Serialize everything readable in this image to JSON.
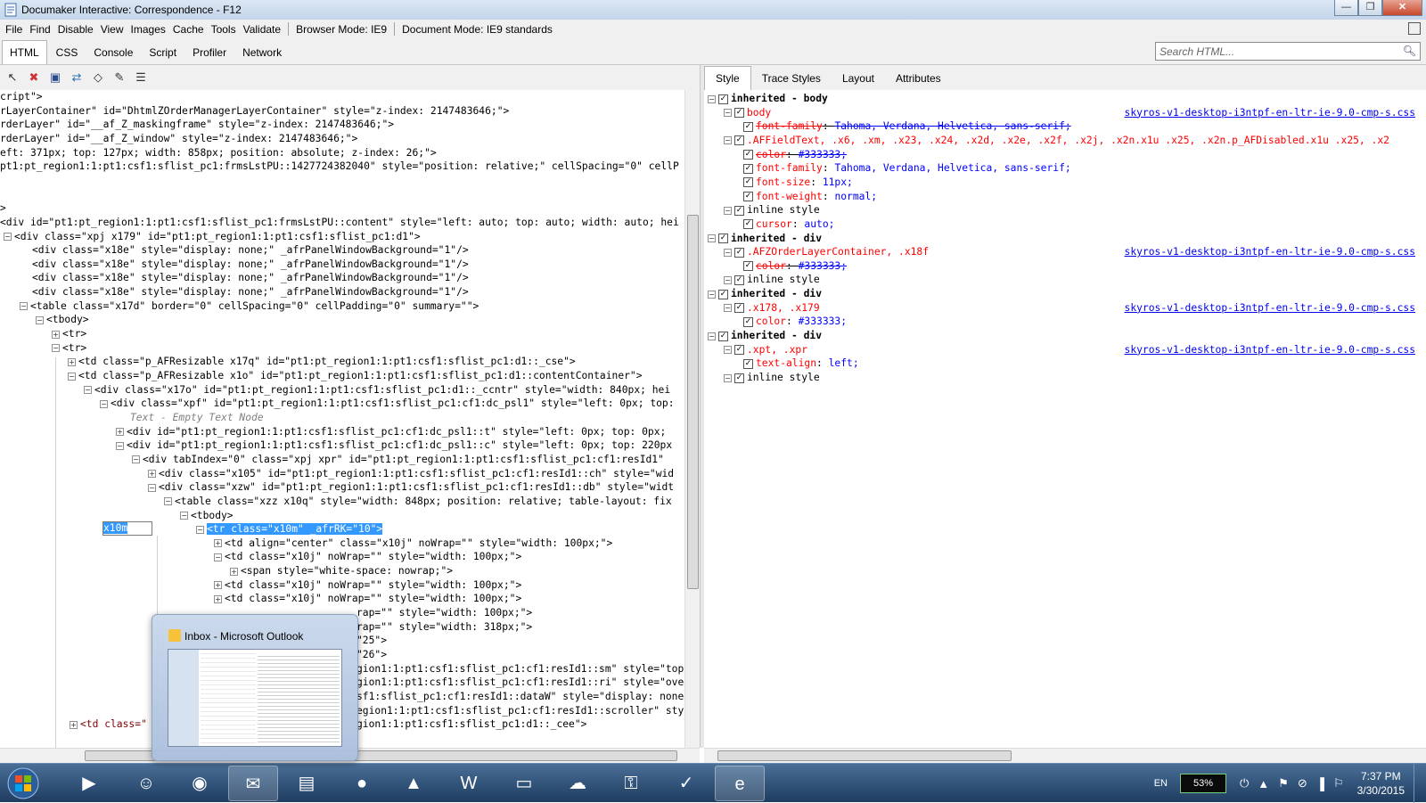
{
  "window": {
    "title": "Documaker Interactive: Correspondence - F12",
    "buttons": [
      "—",
      "❐",
      "✕"
    ]
  },
  "menu": {
    "items": [
      "File",
      "Find",
      "Disable",
      "View",
      "Images",
      "Cache",
      "Tools",
      "Validate"
    ],
    "browser_mode": "Browser Mode: IE9",
    "document_mode": "Document Mode: IE9 standards"
  },
  "tabs": [
    "HTML",
    "CSS",
    "Console",
    "Script",
    "Profiler",
    "Network"
  ],
  "search": {
    "placeholder": "Search HTML..."
  },
  "style_tabs": [
    "Style",
    "Trace Styles",
    "Layout",
    "Attributes"
  ],
  "edit_value": "x10m",
  "html_lines": [
    {
      "t": "cript\">",
      "ind": 0,
      "tog": ""
    },
    {
      "t": "rLayerContainer\" id=\"DhtmlZOrderManagerLayerContainer\" style=\"z-index: 2147483646;\">",
      "ind": 0,
      "tog": ""
    },
    {
      "t": "rderLayer\" id=\"__af_Z_maskingframe\" style=\"z-index: 2147483646;\">",
      "ind": 0,
      "tog": ""
    },
    {
      "t": "rderLayer\" id=\"__af_Z_window\" style=\"z-index: 2147483646;\">",
      "ind": 0,
      "tog": ""
    },
    {
      "t": "eft: 371px; top: 127px; width: 858px; position: absolute; z-index: 26;\">",
      "ind": 0,
      "tog": ""
    },
    {
      "t": "pt1:pt_region1:1:pt1:csf1:sflist_pc1:frmsLstPU::1427724382040\" style=\"position: relative;\" cellSpacing=\"0\" cellP",
      "ind": 0,
      "tog": ""
    },
    {
      "t": "",
      "ind": 0,
      "tog": ""
    },
    {
      "t": "",
      "ind": 0,
      "tog": ""
    },
    {
      "t": ">",
      "ind": 0,
      "tog": ""
    },
    {
      "t": "<div id=\"pt1:pt_region1:1:pt1:csf1:sflist_pc1:frmsLstPU::content\" style=\"left: auto; top: auto; width: auto; hei",
      "ind": 0,
      "tog": ""
    },
    {
      "t": "<div class=\"xpj x179\" id=\"pt1:pt_region1:1:pt1:csf1:sflist_pc1:d1\">",
      "ind": 4,
      "tog": "−"
    },
    {
      "t": "<div class=\"x18e\" style=\"display: none;\" _afrPanelWindowBackground=\"1\"/>",
      "ind": 36,
      "tog": ""
    },
    {
      "t": "<div class=\"x18e\" style=\"display: none;\" _afrPanelWindowBackground=\"1\"/>",
      "ind": 36,
      "tog": ""
    },
    {
      "t": "<div class=\"x18e\" style=\"display: none;\" _afrPanelWindowBackground=\"1\"/>",
      "ind": 36,
      "tog": ""
    },
    {
      "t": "<div class=\"x18e\" style=\"display: none;\" _afrPanelWindowBackground=\"1\"/>",
      "ind": 36,
      "tog": ""
    },
    {
      "t": "<table class=\"x17d\" border=\"0\" cellSpacing=\"0\" cellPadding=\"0\" summary=\"\">",
      "ind": 22,
      "tog": "−"
    },
    {
      "t": "<tbody>",
      "ind": 40,
      "tog": "−"
    },
    {
      "t": "<tr>",
      "ind": 58,
      "tog": "+"
    },
    {
      "t": "<tr>",
      "ind": 58,
      "tog": "−"
    },
    {
      "t": "<td class=\"p_AFResizable x17q\" id=\"pt1:pt_region1:1:pt1:csf1:sflist_pc1:d1::_cse\">",
      "ind": 76,
      "tog": "+"
    },
    {
      "t": "<td class=\"p_AFResizable x1o\" id=\"pt1:pt_region1:1:pt1:csf1:sflist_pc1:d1::contentContainer\">",
      "ind": 76,
      "tog": "−"
    },
    {
      "t": "<div class=\"x17o\" id=\"pt1:pt_region1:1:pt1:csf1:sflist_pc1:d1::_ccntr\" style=\"width: 840px; hei",
      "ind": 94,
      "tog": "−"
    },
    {
      "t": "<div class=\"xpf\" id=\"pt1:pt_region1:1:pt1:csf1:sflist_pc1:cf1:dc_psl1\" style=\"left: 0px; top:",
      "ind": 112,
      "tog": "−"
    },
    {
      "t": "Text - Empty Text Node",
      "ind": 146,
      "tog": "",
      "g": true
    },
    {
      "t": "<div id=\"pt1:pt_region1:1:pt1:csf1:sflist_pc1:cf1:dc_psl1::t\" style=\"left: 0px; top: 0px;",
      "ind": 130,
      "tog": "+"
    },
    {
      "t": "<div id=\"pt1:pt_region1:1:pt1:csf1:sflist_pc1:cf1:dc_psl1::c\" style=\"left: 0px; top: 220px",
      "ind": 130,
      "tog": "−"
    },
    {
      "t": "<div tabIndex=\"0\" class=\"xpj xpr\" id=\"pt1:pt_region1:1:pt1:csf1:sflist_pc1:cf1:resId1\"",
      "ind": 148,
      "tog": "−"
    },
    {
      "t": "<div class=\"x105\" id=\"pt1:pt_region1:1:pt1:csf1:sflist_pc1:cf1:resId1::ch\" style=\"wid",
      "ind": 166,
      "tog": "+"
    },
    {
      "t": "<div class=\"xzw\" id=\"pt1:pt_region1:1:pt1:csf1:sflist_pc1:cf1:resId1::db\" style=\"widt",
      "ind": 166,
      "tog": "−"
    },
    {
      "t": "<table class=\"xzz x10q\" style=\"width: 848px; position: relative; table-layout: fix",
      "ind": 184,
      "tog": "−"
    },
    {
      "t": "<tbody>",
      "ind": 202,
      "tog": "−"
    },
    {
      "t": "<tr class=\"x10m\" _afrRK=\"10\">",
      "ind": 220,
      "tog": "−",
      "hl": true
    },
    {
      "t": "<td align=\"center\" class=\"x10j\" noWrap=\"\" style=\"width: 100px;\">",
      "ind": 240,
      "tog": "+"
    },
    {
      "t": "<td class=\"x10j\" noWrap=\"\" style=\"width: 100px;\">",
      "ind": 240,
      "tog": "−"
    },
    {
      "t": "<span style=\"white-space: nowrap;\">",
      "ind": 258,
      "tog": "+"
    },
    {
      "t": "<td class=\"x10j\" noWrap=\"\" style=\"width: 100px;\">",
      "ind": 240,
      "tog": "+"
    },
    {
      "t": "<td class=\"x10j\" noWrap=\"\" style=\"width: 100px;\">",
      "ind": 240,
      "tog": "+"
    },
    {
      "t": "rap=\"\" style=\"width: 100px;\">",
      "ind": 400,
      "tog": ""
    },
    {
      "t": "rap=\"\" style=\"width: 318px;\">",
      "ind": 400,
      "tog": ""
    },
    {
      "t": "\"25\">",
      "ind": 400,
      "tog": ""
    },
    {
      "t": "\"26\">",
      "ind": 400,
      "tog": ""
    },
    {
      "t": "gion1:1:pt1:csf1:sflist_pc1:cf1:resId1::sm\" style=\"top",
      "ind": 400,
      "tog": ""
    },
    {
      "t": "gion1:1:pt1:csf1:sflist_pc1:cf1:resId1::ri\" style=\"ove",
      "ind": 400,
      "tog": ""
    },
    {
      "t": "sf1:sflist_pc1:cf1:resId1::dataW\" style=\"display: none",
      "ind": 400,
      "tog": ""
    },
    {
      "t": "egion1:1:pt1:csf1:sflist_pc1:cf1:resId1::scroller\" sty",
      "ind": 400,
      "tog": ""
    },
    {
      "t": "gion1:1:pt1:csf1:sflist_pc1:d1::_cee\">",
      "ind": 400,
      "tog": ""
    }
  ],
  "td_class_stub": "<td class=\"",
  "style_lines": [
    {
      "kind": "sec",
      "ind": 0,
      "text": "inherited - body",
      "tog": "−"
    },
    {
      "kind": "rule",
      "ind": 18,
      "text": "body",
      "tog": "−",
      "link": "skyros-v1-desktop-i3ntpf-en-ltr-ie-9.0-cmp-s.css"
    },
    {
      "kind": "prop",
      "ind": 40,
      "name": "font-family",
      "val": "Tahoma, Verdana, Helvetica, sans-serif;",
      "strike": true
    },
    {
      "kind": "rule",
      "ind": 18,
      "text": ".AFFieldText, .x6, .xm, .x23, .x24, .x2d, .x2e, .x2f, .x2j, .x2n.x1u .x25, .x2n.p_AFDisabled.x1u .x25, .x2",
      "tog": "−"
    },
    {
      "kind": "prop",
      "ind": 40,
      "name": "color",
      "val": "#333333;",
      "strike": true
    },
    {
      "kind": "prop",
      "ind": 40,
      "name": "font-family",
      "val": "Tahoma, Verdana, Helvetica, sans-serif;",
      "strike": false
    },
    {
      "kind": "prop",
      "ind": 40,
      "name": "font-size",
      "val": "11px;",
      "strike": false
    },
    {
      "kind": "prop",
      "ind": 40,
      "name": "font-weight",
      "val": "normal;",
      "strike": false
    },
    {
      "kind": "inl",
      "ind": 18,
      "text": "inline style",
      "tog": "−"
    },
    {
      "kind": "prop",
      "ind": 40,
      "name": "cursor",
      "val": "auto;",
      "strike": false
    },
    {
      "kind": "sec",
      "ind": 0,
      "text": "inherited - div",
      "tog": "−"
    },
    {
      "kind": "rule",
      "ind": 18,
      "text": ".AFZOrderLayerContainer, .x18f",
      "tog": "−",
      "link": "skyros-v1-desktop-i3ntpf-en-ltr-ie-9.0-cmp-s.css"
    },
    {
      "kind": "prop",
      "ind": 40,
      "name": "color",
      "val": "#333333;",
      "strike": true
    },
    {
      "kind": "inl",
      "ind": 18,
      "text": "inline style",
      "tog": "−"
    },
    {
      "kind": "sec",
      "ind": 0,
      "text": "inherited - div",
      "tog": "−"
    },
    {
      "kind": "rule",
      "ind": 18,
      "text": ".x178, .x179",
      "tog": "−",
      "link": "skyros-v1-desktop-i3ntpf-en-ltr-ie-9.0-cmp-s.css"
    },
    {
      "kind": "prop",
      "ind": 40,
      "name": "color",
      "val": "#333333;",
      "strike": false
    },
    {
      "kind": "sec",
      "ind": 0,
      "text": "inherited - div",
      "tog": "−"
    },
    {
      "kind": "rule",
      "ind": 18,
      "text": ".xpt, .xpr",
      "tog": "−",
      "link": "skyros-v1-desktop-i3ntpf-en-ltr-ie-9.0-cmp-s.css"
    },
    {
      "kind": "prop",
      "ind": 40,
      "name": "text-align",
      "val": "left;",
      "strike": false
    },
    {
      "kind": "inl",
      "ind": 18,
      "text": "inline style",
      "tog": "−"
    }
  ],
  "thumbnail": {
    "title": "Inbox - Microsoft Outlook"
  },
  "tray": {
    "lang": "EN",
    "battery": "53%",
    "time": "7:37 PM",
    "date": "3/30/2015"
  },
  "colors": {
    "tag": "#800000",
    "attr_name": "#ff0000",
    "attr_value": "#0000ff",
    "selection": "#3399ff",
    "link": "#0000ee"
  }
}
